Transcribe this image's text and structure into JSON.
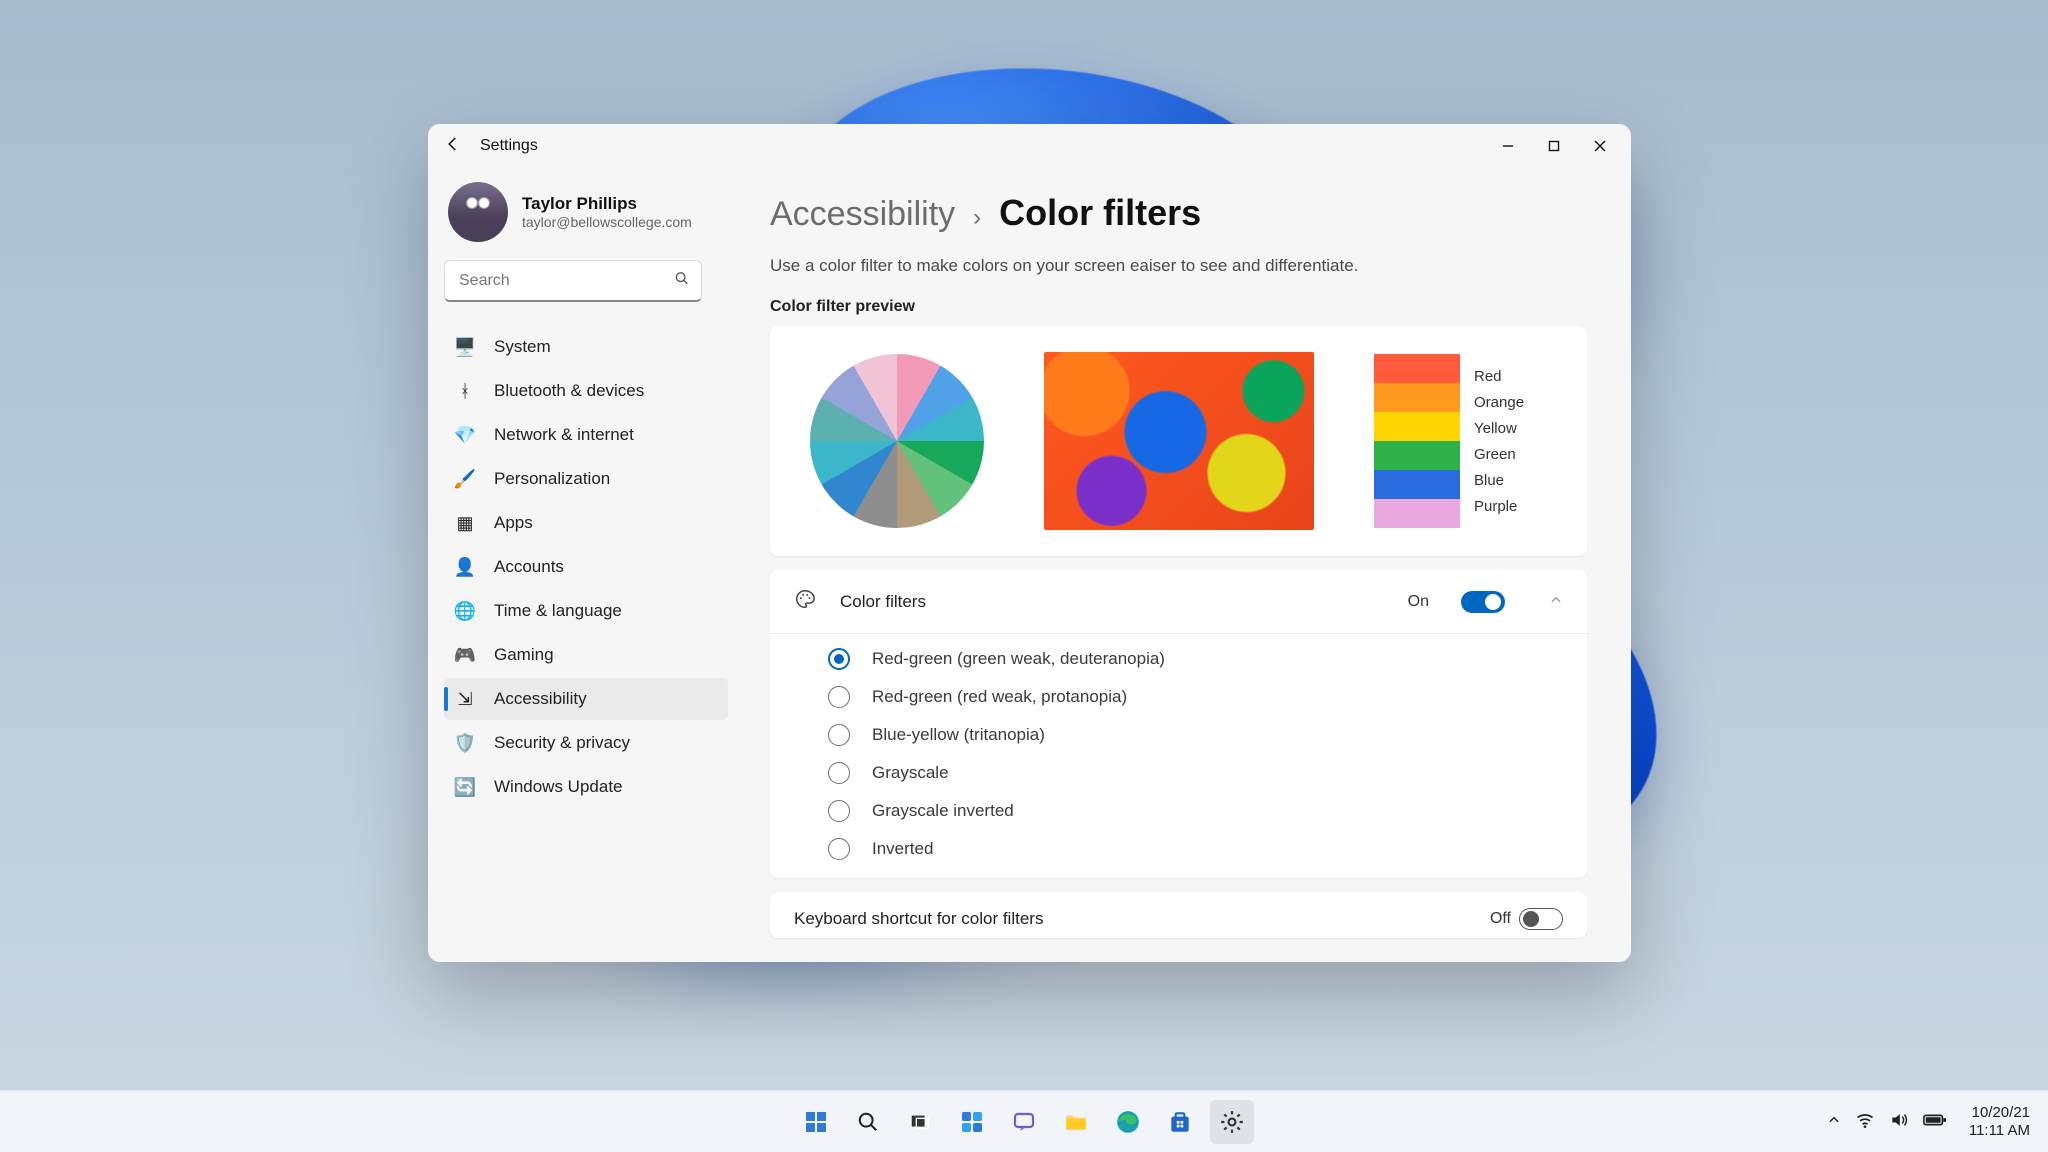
{
  "window": {
    "title": "Settings"
  },
  "user": {
    "name": "Taylor Phillips",
    "email": "taylor@bellowscollege.com"
  },
  "search": {
    "placeholder": "Search"
  },
  "nav": {
    "items": [
      {
        "id": "system",
        "label": "System",
        "icon": "🖥️"
      },
      {
        "id": "bluetooth",
        "label": "Bluetooth & devices",
        "icon": "ᚼ"
      },
      {
        "id": "network",
        "label": "Network & internet",
        "icon": "💎"
      },
      {
        "id": "personalization",
        "label": "Personalization",
        "icon": "🖌️"
      },
      {
        "id": "apps",
        "label": "Apps",
        "icon": "▦"
      },
      {
        "id": "accounts",
        "label": "Accounts",
        "icon": "👤"
      },
      {
        "id": "time",
        "label": "Time & language",
        "icon": "🌐"
      },
      {
        "id": "gaming",
        "label": "Gaming",
        "icon": "🎮"
      },
      {
        "id": "accessibility",
        "label": "Accessibility",
        "icon": "⇲"
      },
      {
        "id": "privacy",
        "label": "Security & privacy",
        "icon": "🛡️"
      },
      {
        "id": "update",
        "label": "Windows Update",
        "icon": "🔄"
      }
    ],
    "activeIndex": 8
  },
  "breadcrumb": {
    "parent": "Accessibility",
    "separator": "›",
    "current": "Color filters"
  },
  "description": "Use a color filter to make colors on your screen eaiser to see and differentiate.",
  "preview": {
    "label": "Color filter preview",
    "swatches": [
      {
        "label": "Red",
        "color": "#ff5a3c"
      },
      {
        "label": "Orange",
        "color": "#ff9a1f"
      },
      {
        "label": "Yellow",
        "color": "#ffd400"
      },
      {
        "label": "Green",
        "color": "#2fb14a"
      },
      {
        "label": "Blue",
        "color": "#2a6be0"
      },
      {
        "label": "Purple",
        "color": "#e9a9e0"
      }
    ]
  },
  "filters": {
    "header": "Color filters",
    "stateLabel": "On",
    "stateOn": true,
    "options": [
      "Red-green (green weak, deuteranopia)",
      "Red-green (red weak, protanopia)",
      "Blue-yellow (tritanopia)",
      "Grayscale",
      "Grayscale inverted",
      "Inverted"
    ],
    "selectedIndex": 0
  },
  "shortcut": {
    "label": "Keyboard shortcut for color filters",
    "stateLabel": "Off",
    "stateOn": false
  },
  "taskbar": {
    "date": "10/20/21",
    "time": "11:11 AM"
  }
}
